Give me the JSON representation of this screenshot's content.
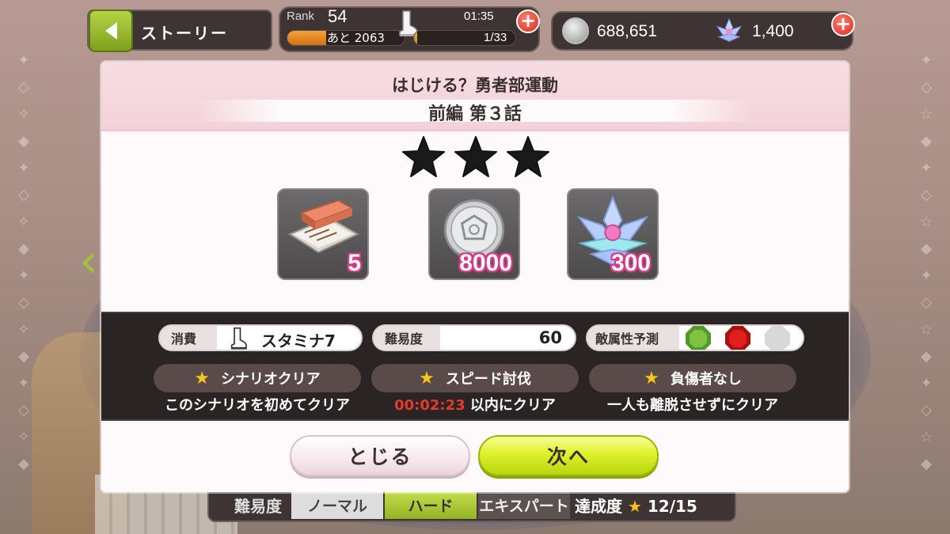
{
  "hud": {
    "back_label": "ストーリー",
    "rank_label": "Rank",
    "rank_value": "54",
    "exp_next": "あと 2063",
    "exp_progress": 0.33,
    "stamina_timer": "01:35",
    "stamina_count": "1/33",
    "stamina_progress": 0.03,
    "coins": "688,651",
    "gems": "1,400"
  },
  "modal": {
    "title": "はじける？勇者部運動",
    "chapter": "前編 第３話",
    "stars_earned": 3,
    "rewards": [
      {
        "icon": "ticket-icon",
        "qty": "5"
      },
      {
        "icon": "silver-coin-icon",
        "qty": "8000"
      },
      {
        "icon": "lotus-icon",
        "qty": "300"
      }
    ],
    "cost_label": "消費",
    "cost_value": "スタミナ7",
    "difficulty_label": "難易度",
    "difficulty_value": "60",
    "enemy_attr_label": "敵属性予測",
    "enemy_attrs": [
      "green",
      "red",
      "none"
    ],
    "conditions": [
      {
        "name": "シナリオクリア",
        "desc": "このシナリオを初めてクリア"
      },
      {
        "name": "スピード討伐",
        "time": "00:02:23",
        "desc": " 以内にクリア"
      },
      {
        "name": "負傷者なし",
        "desc": "一人も離脱させずにクリア"
      }
    ],
    "close_button": "とじる",
    "next_button": "次へ"
  },
  "difficulty_bar": {
    "label": "難易度",
    "tabs": [
      "ノーマル",
      "ハード",
      "エキスパート"
    ],
    "selected": "ハード",
    "achievement_label": "達成度",
    "achievement_value": "12/15"
  },
  "colors": {
    "accent_green": "#b5d446",
    "accent_red": "#d72f1f",
    "reward_qty_outline": "#d83a8a",
    "time_red": "#e53a2a"
  }
}
